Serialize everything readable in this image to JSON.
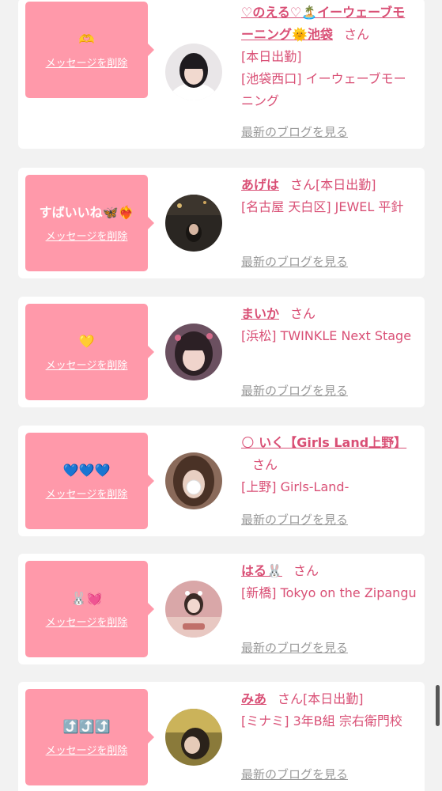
{
  "common": {
    "delete_label": "メッセージを削除",
    "san_label": "さん",
    "blog_link": "最新のブログを見る"
  },
  "cards": [
    {
      "message": "🫶",
      "name": "♡のえる♡🏝️イーウェーブモーニング🌞池袋",
      "status": "[本日出勤]",
      "shop": "[池袋西口] イーウェーブモーニング"
    },
    {
      "message": "すばいいね🦋❤️‍🔥",
      "name": "あげは",
      "status": "[本日出勤]",
      "shop": "[名古屋 天白区] JEWEL 平針"
    },
    {
      "message": "💛",
      "name": "まいか",
      "status": "",
      "shop": "[浜松] TWINKLE Next Stage"
    },
    {
      "message": "💙💙💙",
      "name": "🌕 いく【Girls Land上野】",
      "status": "",
      "shop": "[上野] Girls-Land-"
    },
    {
      "message": "🐰💓",
      "name": "はる🐰",
      "status": "",
      "shop": "[新橋] Tokyo on the Zipangu"
    },
    {
      "message": "⤴️⤴️⤴️",
      "name": "みあ",
      "status": "[本日出勤]",
      "shop": "[ミナミ] 3年B組 宗右衛門校"
    }
  ]
}
